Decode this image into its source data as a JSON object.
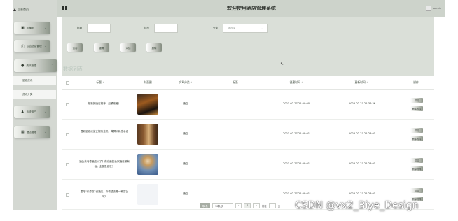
{
  "sidebar": {
    "brand": "后台首页",
    "items": [
      {
        "label": "轮播图",
        "icon": "image-icon"
      },
      {
        "label": "公告信息管理",
        "icon": "info-icon"
      },
      {
        "label": "资讯管理",
        "icon": "pin-icon"
      },
      {
        "label": "系统用户",
        "icon": "user-icon"
      },
      {
        "label": "酒店管理",
        "icon": "grid-icon"
      }
    ],
    "sub_items": [
      "酒店资讯",
      "资讯分类"
    ]
  },
  "header": {
    "title": "欢迎使用酒店管理系统",
    "user_label": "admin"
  },
  "filters": {
    "title_label": "标题",
    "tags_label": "标签",
    "category_label": "分类",
    "category_placeholder": "请选择"
  },
  "toolbar": {
    "query": "查询",
    "reset": "重置",
    "add": "添加",
    "delete": "删除"
  },
  "list_title": "数据列表",
  "table": {
    "columns": [
      "标题",
      "封面图",
      "文章分类",
      "标签",
      "创建时间",
      "更新时间",
      "操作"
    ],
    "rows": [
      {
        "title": "超赞的酒店推荐，赶紧收藏！",
        "category": "酒店",
        "tags": "",
        "created": "2023-02-27 21:29:00",
        "updated": "2023-02-27 21:34:36",
        "cover": "night-street"
      },
      {
        "title": "看城酒店经营正规有生机，弹屏头和总承诺",
        "category": "酒店",
        "tags": "",
        "created": "2023-02-27 21:28:01",
        "updated": "2023-02-27 21:28:01",
        "cover": "hotel-door"
      },
      {
        "title": "酒会未马春酒店火了？南京面的业家酒店景有画，全都是酒驻！",
        "category": "酒店",
        "tags": "",
        "created": "2023-02-27 21:28:01",
        "updated": "2023-02-27 21:28:01",
        "cover": "statue"
      },
      {
        "title": "重阳“长寿宴”设酒店，你希望去哪一种宴会吗？",
        "category": "酒店",
        "tags": "",
        "created": "2023-02-27 21:28:01",
        "updated": "2023-02-27 21:28:01",
        "cover": "blank"
      }
    ],
    "actions": [
      "详情",
      "删除附件"
    ]
  },
  "pagination": {
    "total": "共4条",
    "page_size": "10条/页",
    "current_page": "1",
    "goto_label": "前往",
    "goto_value": "1",
    "suffix": "页"
  },
  "watermark": "CSDN @vx2_Biye_Design"
}
